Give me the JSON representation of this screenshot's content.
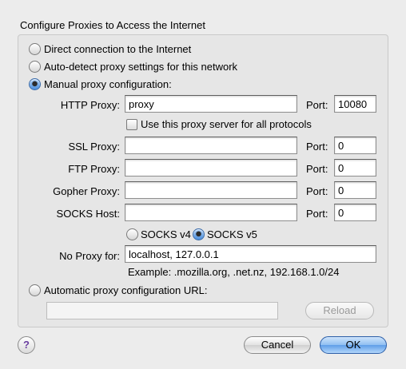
{
  "dialog": {
    "title": "Configure Proxies to Access the Internet"
  },
  "options": {
    "direct": "Direct connection to the Internet",
    "autodetect": "Auto-detect proxy settings for this network",
    "manual": "Manual proxy configuration:",
    "auto_url": "Automatic proxy configuration URL:",
    "selected": "manual"
  },
  "manual": {
    "http_label": "HTTP Proxy:",
    "http_value": "proxy",
    "port_label": "Port:",
    "http_port": "10080",
    "use_all_label": "Use this proxy server for all protocols",
    "use_all_checked": false,
    "ssl_label": "SSL Proxy:",
    "ssl_value": "",
    "ssl_port": "0",
    "ftp_label": "FTP Proxy:",
    "ftp_value": "",
    "ftp_port": "0",
    "gopher_label": "Gopher Proxy:",
    "gopher_value": "",
    "gopher_port": "0",
    "socks_label": "SOCKS Host:",
    "socks_value": "",
    "socks_port": "0",
    "socks_v4": "SOCKS v4",
    "socks_v5": "SOCKS v5",
    "socks_selected": "v5",
    "noproxy_label": "No Proxy for:",
    "noproxy_value": "localhost, 127.0.0.1",
    "example": "Example: .mozilla.org, .net.nz, 192.168.1.0/24"
  },
  "auto": {
    "url_value": "",
    "reload_label": "Reload"
  },
  "buttons": {
    "help": "?",
    "cancel": "Cancel",
    "ok": "OK"
  }
}
